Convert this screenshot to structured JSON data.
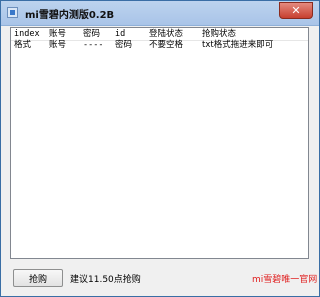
{
  "window": {
    "title": "mi雪碧内测版0.2B",
    "close_symbol": "✕"
  },
  "table": {
    "headers": [
      "index",
      "账号",
      "密码",
      "id",
      "登陆状态",
      "抢购状态"
    ],
    "rows": [
      [
        "格式",
        "账号",
        "----",
        "密码",
        "不要空格",
        "txt格式拖进来即可"
      ]
    ]
  },
  "footer": {
    "grab_button_label": "抢购",
    "hint_text": "建议11.50点抢购",
    "official_link_text": "mi雪碧唯一官网",
    "official_link_color": "#e02020"
  }
}
